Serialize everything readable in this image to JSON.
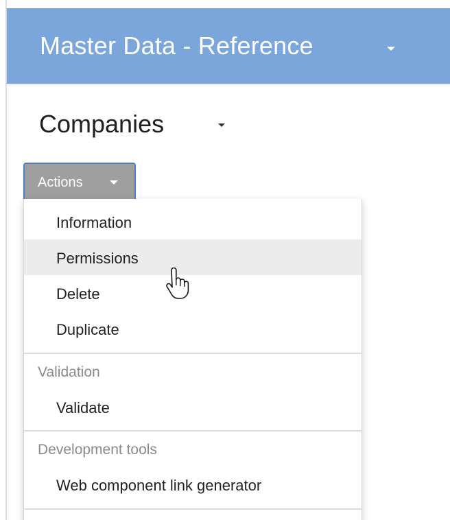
{
  "banner": {
    "title": "Master Data - Reference",
    "background_color": "#7aa6dc",
    "dropdown_icon": "caret-down-icon"
  },
  "section": {
    "title": "Companies",
    "dropdown_icon": "caret-down-icon"
  },
  "actions_button": {
    "label": "Actions",
    "dropdown_icon": "caret-down-icon",
    "state": "open"
  },
  "menu": {
    "items": [
      {
        "label": "Information"
      },
      {
        "label": "Permissions",
        "highlighted": true
      },
      {
        "label": "Delete"
      },
      {
        "label": "Duplicate"
      }
    ],
    "validation_group": {
      "header": "Validation",
      "items": [
        {
          "label": "Validate"
        }
      ]
    },
    "dev_tools_group": {
      "header": "Development tools",
      "items": [
        {
          "label": "Web component link generator"
        }
      ]
    }
  },
  "cursor": {
    "icon": "hand-pointer-icon"
  }
}
